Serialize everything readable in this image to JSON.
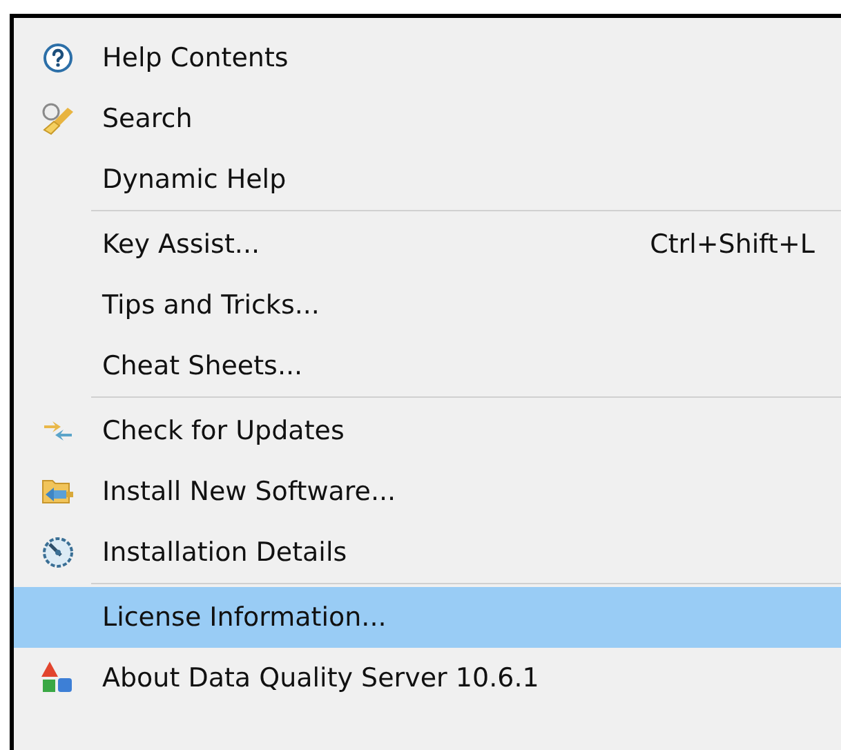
{
  "menu": {
    "groups": [
      {
        "items": [
          {
            "label": "Help Contents",
            "selected": false
          },
          {
            "label": "Search",
            "selected": false
          },
          {
            "label": "Dynamic Help",
            "selected": false
          }
        ]
      },
      {
        "items": [
          {
            "label": "Key Assist...",
            "shortcut": "Ctrl+Shift+L",
            "selected": false
          },
          {
            "label": "Tips and Tricks...",
            "selected": false
          },
          {
            "label": "Cheat Sheets...",
            "selected": false
          }
        ]
      },
      {
        "items": [
          {
            "label": "Check for Updates",
            "selected": false
          },
          {
            "label": "Install New Software...",
            "selected": false
          },
          {
            "label": "Installation Details",
            "selected": false
          }
        ]
      },
      {
        "items": [
          {
            "label": "License Information...",
            "selected": true
          },
          {
            "label": "About Data Quality Server 10.6.1",
            "selected": false
          }
        ]
      }
    ]
  }
}
